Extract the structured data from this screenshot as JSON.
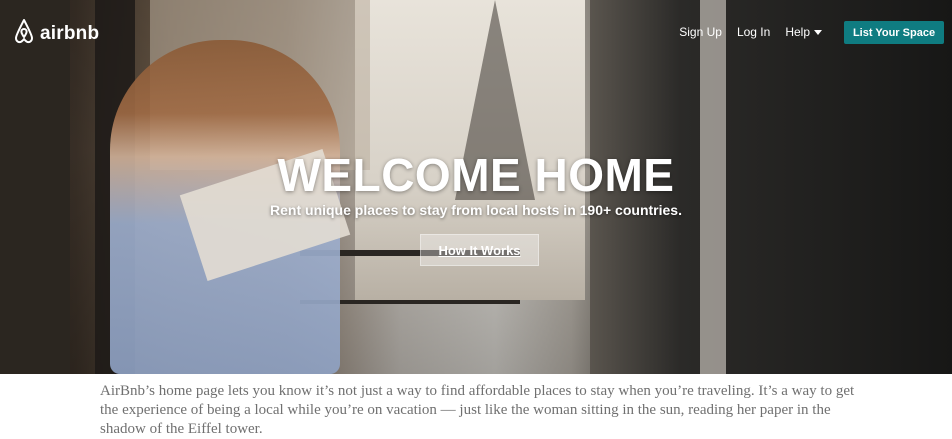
{
  "brand": {
    "name": "airbnb",
    "logo_icon": "airbnb-belo-icon"
  },
  "nav": {
    "sign_up": "Sign Up",
    "log_in": "Log In",
    "help": "Help",
    "list_space": "List Your Space"
  },
  "hero": {
    "headline": "WELCOME HOME",
    "subtitle": "Rent unique places to stay from local hosts in 190+ countries.",
    "cta": "How It Works"
  },
  "caption": "AirBnb’s home page lets you know it’s not just a way to find affordable places to stay when you’re traveling. It’s a way to get the experience of being a local while you’re on vacation — just like the woman sitting in the sun, reading her paper in the shadow of the Eiffel tower.",
  "colors": {
    "accent": "#0f7c81",
    "text_light": "#ffffff",
    "caption": "#707070"
  }
}
